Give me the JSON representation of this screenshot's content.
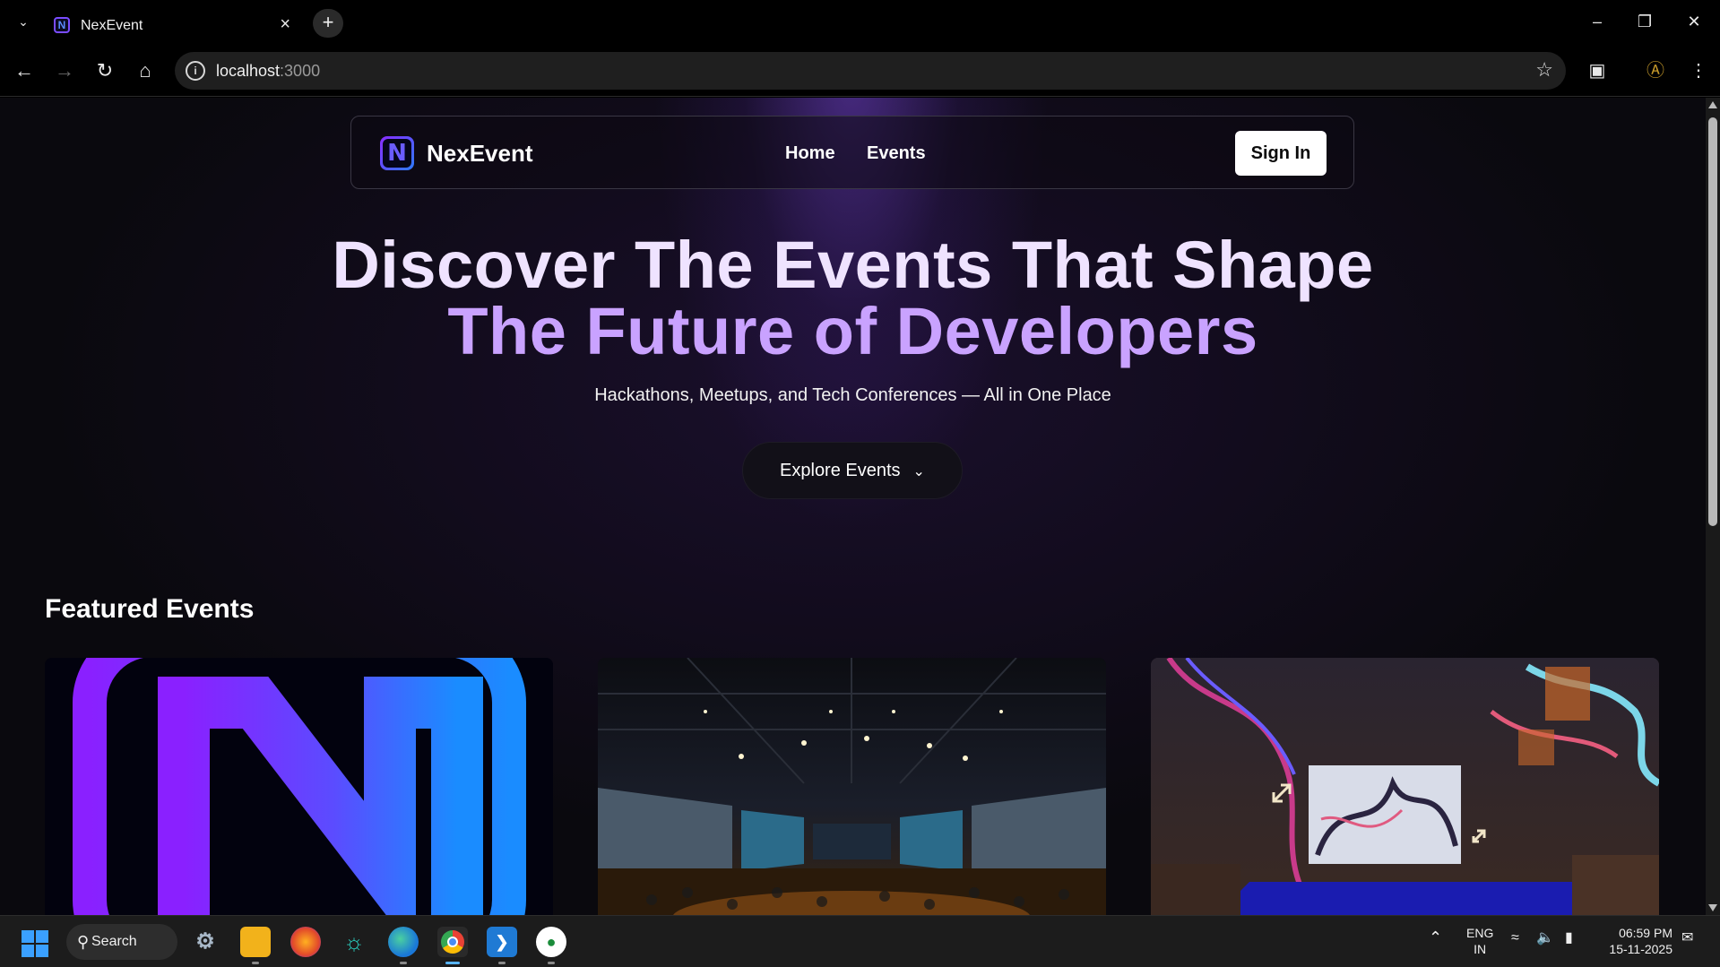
{
  "browser": {
    "tab_title": "NexEvent",
    "favicon_letter": "N",
    "url_host": "localhost",
    "url_port": ":3000"
  },
  "site": {
    "brand": "NexEvent",
    "logo_letter": "N",
    "nav": [
      "Home",
      "Events"
    ],
    "sign_in": "Sign In"
  },
  "hero": {
    "line1": "Discover The Events That Shape",
    "line2": "The Future of Developers",
    "subtitle": "Hackathons, Meetups, and Tech Conferences — All in One Place",
    "cta": "Explore Events"
  },
  "featured": {
    "title": "Featured Events",
    "cards": [
      {
        "image": "nexevent-logo"
      },
      {
        "image": "conference-hall"
      },
      {
        "image": "immersive-stage"
      }
    ]
  },
  "colors": {
    "accent_purple": "#c9a2ff",
    "hero_light": "#efe3ff",
    "logo_gradient_start": "#8a2cff",
    "logo_gradient_end": "#2c7bff"
  },
  "taskbar": {
    "search_label": "Search",
    "language_line1": "ENG",
    "language_line2": "IN",
    "time": "06:59 PM",
    "date": "15-11-2025"
  }
}
